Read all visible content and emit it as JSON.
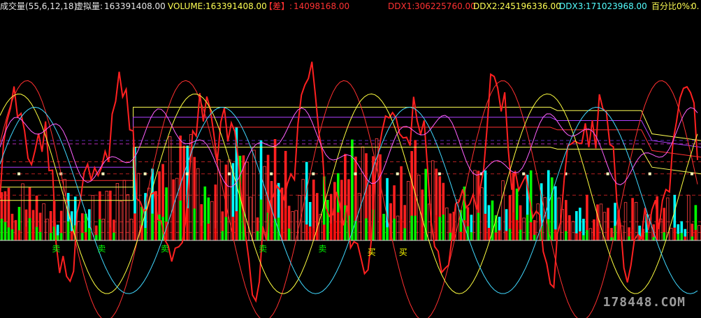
{
  "header": {
    "indicator_name": "成交量(55,6,12,18)",
    "virtual_label": "虚拟量:",
    "virtual_value": "163391408.00",
    "volume_label": "VOLUME:",
    "volume_value": "163391408.00",
    "diff_label": "【差】:",
    "diff_value": "14098168.00",
    "ddx1_label": "DDX1:",
    "ddx1_value": "306225760.00",
    "ddx2_label": "DDX2:",
    "ddx2_value": "245196336.00",
    "ddx3_label": "DDX3:",
    "ddx3_value": "171023968.00",
    "pct_label": "百分比0%:",
    "pct_value": "0.",
    "colors": {
      "white": "#e6e6e6",
      "yellow": "#ffff54",
      "red": "#ff3232",
      "cyan": "#54ffff",
      "pink": "#ff54ff"
    }
  },
  "watermark": "178448.COM",
  "chart_data": {
    "type": "bar",
    "count": 200,
    "baseline": 0,
    "ylim": [
      -160,
      340
    ],
    "bar_colors": [
      "#ff2020",
      "#00ffff",
      "#00ff00"
    ],
    "signals": [
      {
        "label": "卖",
        "index": 16,
        "color": "#00ff00"
      },
      {
        "label": "卖",
        "index": 29,
        "color": "#00ff00"
      },
      {
        "label": "卖",
        "index": 47,
        "color": "#00ff00"
      },
      {
        "label": "卖",
        "index": 75,
        "color": "#00ff00"
      },
      {
        "label": "卖",
        "index": 92,
        "color": "#00ff00"
      },
      {
        "label": "买",
        "index": 106,
        "color": "#ffff00"
      },
      {
        "label": "买",
        "index": 115,
        "color": "#ffff00"
      }
    ],
    "reference_levels": [
      {
        "name": "ma-yellow",
        "color": "#ffff54",
        "points": [
          [
            0,
            60
          ],
          [
            38,
            60
          ],
          [
            38,
            200
          ],
          [
            157,
            200
          ],
          [
            159,
            195
          ],
          [
            183,
            195
          ],
          [
            186,
            160
          ],
          [
            200,
            150
          ]
        ]
      },
      {
        "name": "ma-purple",
        "color": "#b040ff",
        "points": [
          [
            0,
            110
          ],
          [
            38,
            110
          ],
          [
            38,
            185
          ],
          [
            157,
            185
          ],
          [
            159,
            180
          ],
          [
            183,
            180
          ],
          [
            186,
            150
          ],
          [
            200,
            140
          ]
        ]
      },
      {
        "name": "ma-red",
        "color": "#ff3030",
        "points": [
          [
            0,
            90
          ],
          [
            38,
            90
          ],
          [
            38,
            170
          ],
          [
            157,
            170
          ],
          [
            159,
            166
          ],
          [
            183,
            166
          ],
          [
            186,
            135
          ],
          [
            200,
            125
          ]
        ]
      },
      {
        "name": "ma-yellow-2",
        "color": "#ffff54",
        "points": [
          [
            0,
            80
          ],
          [
            38,
            80
          ],
          [
            38,
            140
          ],
          [
            157,
            140
          ],
          [
            159,
            137
          ],
          [
            183,
            137
          ],
          [
            186,
            110
          ],
          [
            200,
            100
          ]
        ]
      }
    ],
    "oscillators": [
      {
        "name": "red-fast",
        "color": "#ff2020",
        "width": 2
      },
      {
        "name": "red-slow",
        "color": "#ff3030",
        "width": 1
      },
      {
        "name": "yellow",
        "color": "#ffff40",
        "width": 1
      },
      {
        "name": "cyan",
        "color": "#40d8ff",
        "width": 1
      },
      {
        "name": "pink",
        "color": "#ff60ff",
        "width": 1
      }
    ]
  }
}
